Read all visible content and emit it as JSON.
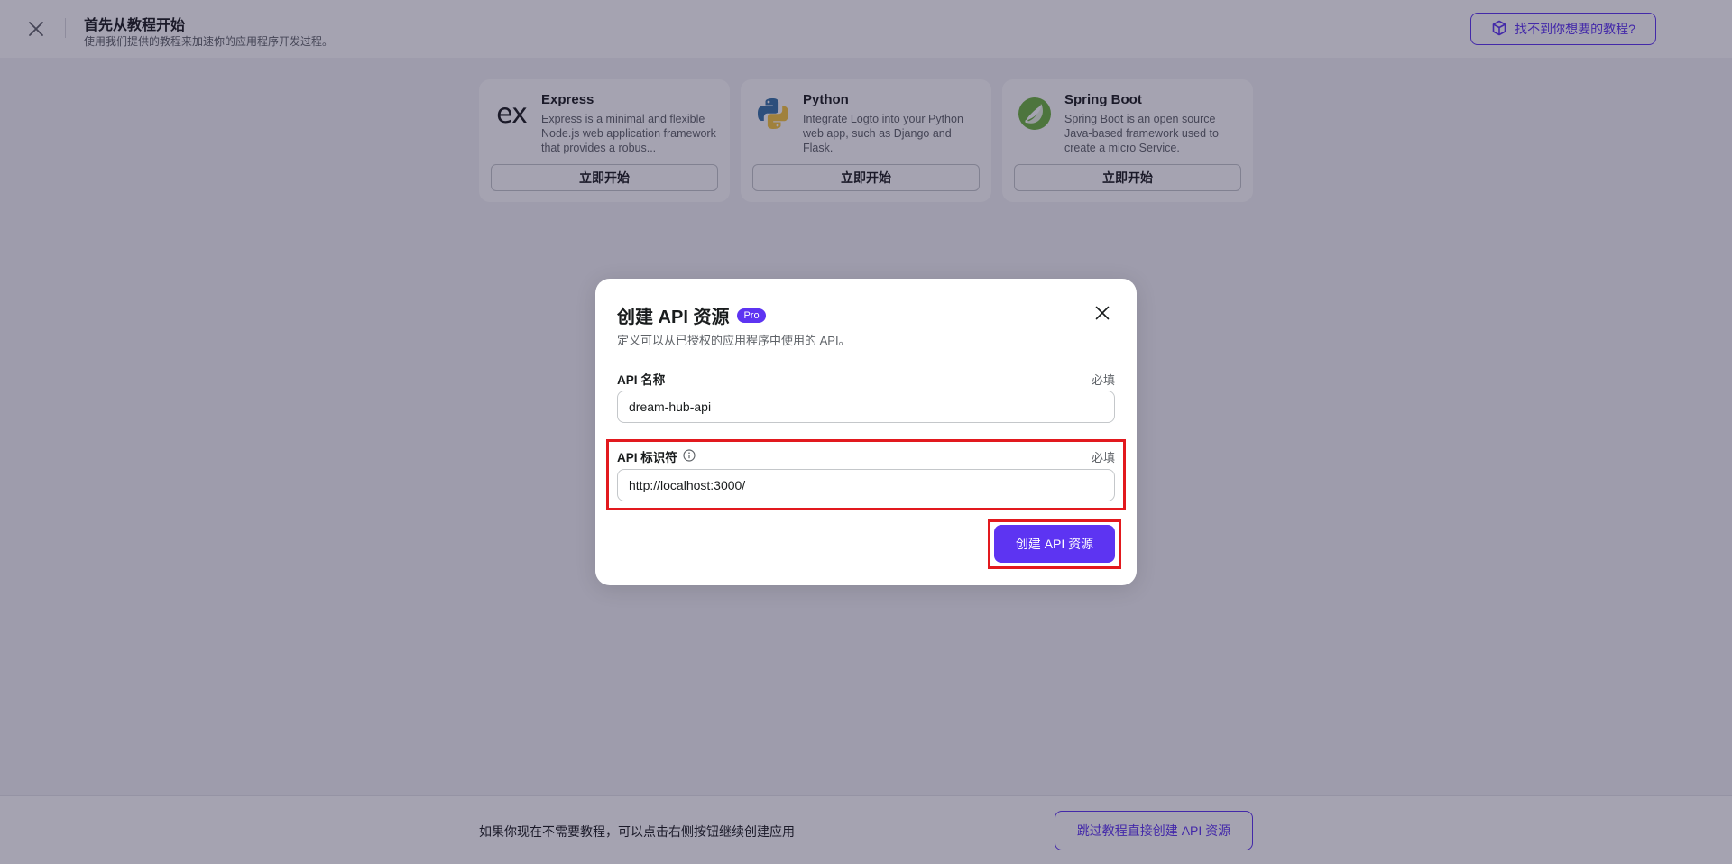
{
  "header": {
    "title": "首先从教程开始",
    "subtitle": "使用我们提供的教程来加速你的应用程序开发过程。",
    "help_button": "找不到你想要的教程?"
  },
  "cards": [
    {
      "name": "Express",
      "description": "Express is a minimal and flexible Node.js web application framework that provides a robus...",
      "button": "立即开始",
      "logo_text": "ex"
    },
    {
      "name": "Python",
      "description": "Integrate Logto into your Python web app, such as Django and Flask.",
      "button": "立即开始"
    },
    {
      "name": "Spring Boot",
      "description": "Spring Boot is an open source Java-based framework used to create a micro Service.",
      "button": "立即开始"
    }
  ],
  "footer": {
    "text": "如果你现在不需要教程，可以点击右侧按钮继续创建应用",
    "skip_button": "跳过教程直接创建 API 资源"
  },
  "modal": {
    "title": "创建 API 资源",
    "badge": "Pro",
    "subtitle": "定义可以从已授权的应用程序中使用的 API。",
    "fields": [
      {
        "label": "API 名称",
        "required": "必填",
        "value": "dream-hub-api"
      },
      {
        "label": "API 标识符",
        "required": "必填",
        "value": "http://localhost:3000/"
      }
    ],
    "submit_button": "创建 API 资源"
  },
  "colors": {
    "accent": "#5d34f2",
    "highlight": "#e2191e"
  },
  "icons": {
    "close": "close-icon",
    "help": "cube-icon",
    "info": "info-icon"
  }
}
